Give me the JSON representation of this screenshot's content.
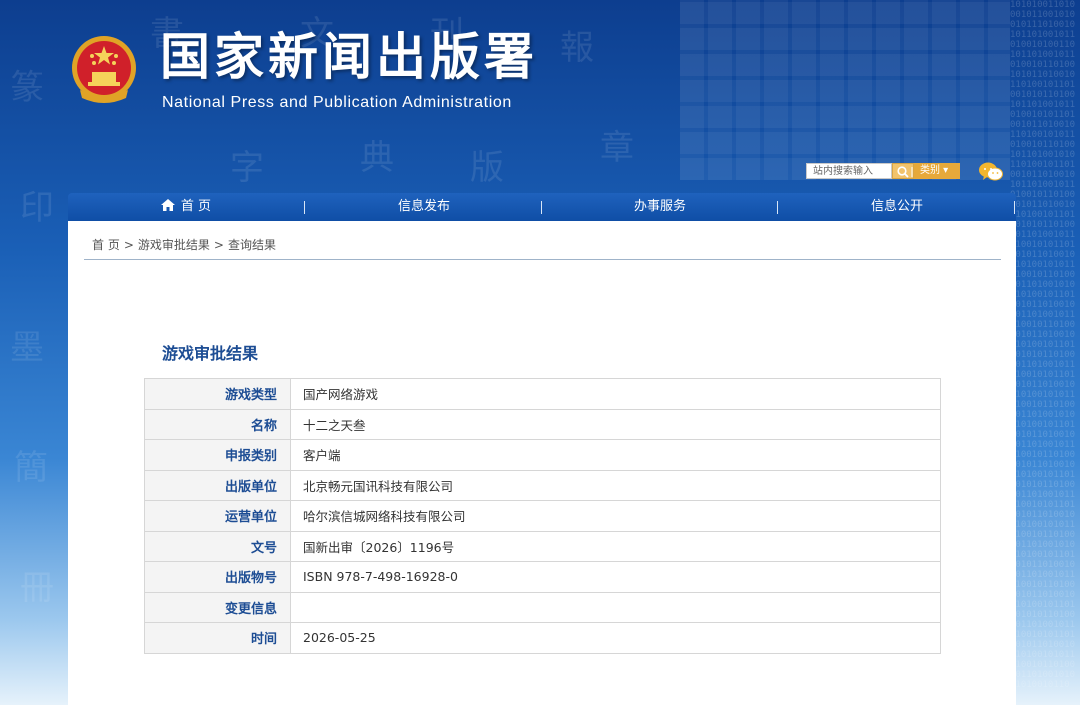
{
  "header": {
    "title_cn": "国家新闻出版署",
    "title_en": "National  Press and Publication Administration"
  },
  "search": {
    "placeholder": "站内搜索输入",
    "category_label": "类别 ▾",
    "search_icon": "search-icon"
  },
  "nav": {
    "items": [
      {
        "label": "首 页",
        "icon": "home-icon"
      },
      {
        "label": "信息发布"
      },
      {
        "label": "办事服务"
      },
      {
        "label": "信息公开"
      }
    ]
  },
  "breadcrumb": {
    "items": [
      "首 页",
      "游戏审批结果",
      "查询结果"
    ],
    "separator": ">"
  },
  "main": {
    "section_title": "游戏审批结果",
    "rows": [
      {
        "label": "游戏类型",
        "value": "国产网络游戏"
      },
      {
        "label": "名称",
        "value": "十二之天叁"
      },
      {
        "label": "申报类别",
        "value": "客户端"
      },
      {
        "label": "出版单位",
        "value": "北京畅元国讯科技有限公司"
      },
      {
        "label": "运营单位",
        "value": "哈尔滨信城网络科技有限公司"
      },
      {
        "label": "文号",
        "value": "国新出审〔2026〕1196号"
      },
      {
        "label": "出版物号",
        "value": "ISBN 978-7-498-16928-0"
      },
      {
        "label": "变更信息",
        "value": ""
      },
      {
        "label": "时间",
        "value": "2026-05-25"
      }
    ]
  },
  "colors": {
    "nav_blue": "#0f4ea6",
    "title_blue": "#1d4d94",
    "accent_orange": "#e7a93a"
  }
}
